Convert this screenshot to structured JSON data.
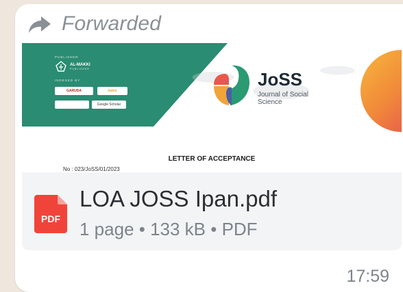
{
  "message": {
    "forwarded_label": "Forwarded",
    "time": "17:59"
  },
  "preview": {
    "publisher_label": "PUBLISHER",
    "publisher_name": "AL-MAKKI",
    "publisher_sub": "PUBLISHER",
    "indexed_label": "INDEXED BY",
    "index_badges": [
      "GARUDA",
      "Index",
      "",
      "Google Scholar"
    ],
    "journal_title": "JoSS",
    "journal_subtitle": "Journal of Social Science",
    "letter_title": "LETTER OF ACCEPTANCE",
    "letter_number": "No    : 023/JoSS/01/2023"
  },
  "file": {
    "icon_label": "PDF",
    "name": "LOA JOSS Ipan.pdf",
    "meta": "1 page • 133 kB • PDF"
  },
  "colors": {
    "banner_green": "#2a8c72",
    "pdf_red": "#f0443a",
    "bubble_bg": "#ffffff",
    "chat_bg": "#efe7dd"
  },
  "icons": {
    "forward": "forward-arrow-icon",
    "file_type": "pdf-file-icon"
  }
}
